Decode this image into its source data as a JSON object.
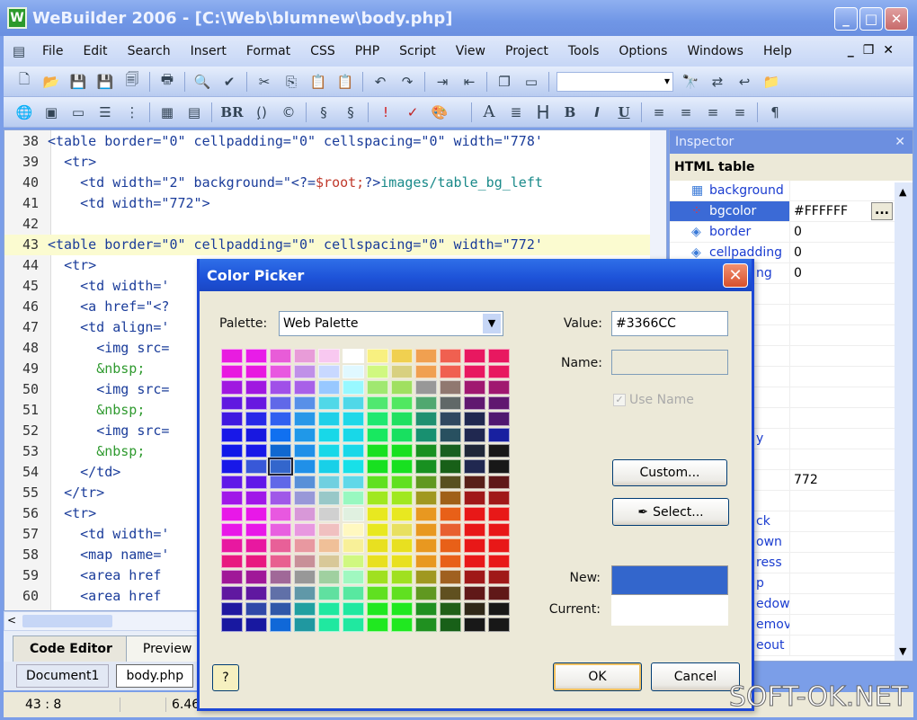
{
  "window": {
    "title": "WeBuilder 2006 - [C:\\Web\\blumnew\\body.php]",
    "app_icon": "W",
    "minimize": "_",
    "maximize": "□",
    "close": "✕"
  },
  "menu": [
    "File",
    "Edit",
    "Search",
    "Insert",
    "Format",
    "CSS",
    "PHP",
    "Script",
    "View",
    "Project",
    "Tools",
    "Options",
    "Windows",
    "Help"
  ],
  "toolbar1": [
    "new",
    "open",
    "save",
    "save-all",
    "save-as",
    "print",
    "preview",
    "spellcheck",
    "cut",
    "copy",
    "paste",
    "paste-special",
    "undo",
    "redo",
    "indent",
    "outdent",
    "window",
    "layout",
    "search-box",
    "find",
    "replace",
    "find-prev",
    "find-in-files"
  ],
  "toolbar2": {
    "icons": [
      "hyperlink",
      "image",
      "hr",
      "list",
      "tag-select",
      "table",
      "form",
      "comment",
      "color-picker"
    ],
    "br": "BR",
    "copyright": "©",
    "font": "A",
    "heading": "H",
    "bold": "B",
    "italic": "I",
    "underline": "U",
    "pilcrow": "¶"
  },
  "editor": {
    "lines": [
      {
        "n": "38",
        "indent": 0,
        "parts": [
          [
            "tag",
            "<table border=\"0\" cellpadding=\"0\" cellspacing=\"0\" width=\"778'"
          ]
        ]
      },
      {
        "n": "39",
        "indent": 1,
        "parts": [
          [
            "tag",
            "<tr>"
          ]
        ]
      },
      {
        "n": "40",
        "indent": 2,
        "parts": [
          [
            "tag",
            "<td width=\"2\" background=\"<?="
          ],
          [
            "php",
            "$root;"
          ],
          [
            "tag",
            "?>"
          ],
          [
            "teal",
            "images/table_bg_left"
          ]
        ]
      },
      {
        "n": "41",
        "indent": 2,
        "parts": [
          [
            "tag",
            "<td width=\"772\">"
          ]
        ]
      },
      {
        "n": "42",
        "indent": 0,
        "parts": []
      },
      {
        "n": "43",
        "indent": 0,
        "hl": true,
        "parts": [
          [
            "tag",
            "<table border=\"0\" cellpadding=\"0\" cellspacing=\"0\" width=\"772'"
          ]
        ]
      },
      {
        "n": "44",
        "indent": 1,
        "parts": [
          [
            "tag",
            "<tr>"
          ]
        ]
      },
      {
        "n": "45",
        "indent": 2,
        "parts": [
          [
            "tag",
            "<td width='"
          ]
        ]
      },
      {
        "n": "46",
        "indent": 2,
        "parts": [
          [
            "tag",
            "<a href=\"<?"
          ]
        ]
      },
      {
        "n": "47",
        "indent": 2,
        "parts": [
          [
            "tag",
            "<td align='"
          ]
        ]
      },
      {
        "n": "48",
        "indent": 3,
        "parts": [
          [
            "tag",
            "<img src="
          ]
        ]
      },
      {
        "n": "49",
        "indent": 3,
        "parts": [
          [
            "grn",
            "&nbsp;"
          ]
        ]
      },
      {
        "n": "50",
        "indent": 3,
        "parts": [
          [
            "tag",
            "<img src="
          ]
        ]
      },
      {
        "n": "51",
        "indent": 3,
        "parts": [
          [
            "grn",
            "&nbsp;"
          ]
        ]
      },
      {
        "n": "52",
        "indent": 3,
        "parts": [
          [
            "tag",
            "<img src="
          ]
        ]
      },
      {
        "n": "53",
        "indent": 3,
        "parts": [
          [
            "grn",
            "&nbsp;"
          ]
        ]
      },
      {
        "n": "54",
        "indent": 2,
        "parts": [
          [
            "tag",
            "</td>"
          ]
        ]
      },
      {
        "n": "55",
        "indent": 1,
        "parts": [
          [
            "tag",
            "</tr>"
          ]
        ]
      },
      {
        "n": "56",
        "indent": 1,
        "parts": [
          [
            "tag",
            "<tr>"
          ]
        ]
      },
      {
        "n": "57",
        "indent": 2,
        "parts": [
          [
            "tag",
            "<td width='"
          ]
        ]
      },
      {
        "n": "58",
        "indent": 2,
        "parts": [
          [
            "tag",
            "<map name='"
          ]
        ]
      },
      {
        "n": "59",
        "indent": 2,
        "parts": [
          [
            "tag",
            "<area href"
          ]
        ]
      },
      {
        "n": "60",
        "indent": 2,
        "parts": [
          [
            "tag",
            "<area href"
          ]
        ]
      }
    ]
  },
  "view_tabs": [
    "Code Editor",
    "Preview"
  ],
  "doc_tabs": [
    "Document1",
    "body.php"
  ],
  "status": {
    "position": "43 : 8",
    "size": "6.46"
  },
  "inspector": {
    "title": "Inspector",
    "close": "✕",
    "subtitle": "HTML table",
    "rows": [
      {
        "name": "background",
        "value": ""
      },
      {
        "name": "bgcolor",
        "value": "#FFFFFF",
        "selected": true
      },
      {
        "name": "border",
        "value": "0"
      },
      {
        "name": "cellpadding",
        "value": "0"
      },
      {
        "name": "ng",
        "value": "0"
      },
      {
        "name": "",
        "value": ""
      },
      {
        "name": "",
        "value": ""
      },
      {
        "name": "",
        "value": ""
      },
      {
        "name": "",
        "value": ""
      },
      {
        "name": "",
        "value": ""
      },
      {
        "name": "",
        "value": ""
      },
      {
        "name": "",
        "value": ""
      },
      {
        "name": "y",
        "value": ""
      },
      {
        "name": "",
        "value": ""
      },
      {
        "name": "",
        "value": "772"
      },
      {
        "name": "",
        "value": ""
      },
      {
        "name": "ck",
        "value": ""
      },
      {
        "name": "own",
        "value": ""
      },
      {
        "name": "ress",
        "value": ""
      },
      {
        "name": "p",
        "value": ""
      },
      {
        "name": "edown",
        "value": ""
      },
      {
        "name": "emov",
        "value": ""
      },
      {
        "name": "eout",
        "value": ""
      }
    ],
    "ellipsis": "..."
  },
  "dialog": {
    "title": "Color Picker",
    "close": "✕",
    "palette_label": "Palette:",
    "palette_value": "Web Palette",
    "value_label": "Value:",
    "value": "#3366CC",
    "name_label": "Name:",
    "name_value": "",
    "use_name_label": "Use Name",
    "use_name_checked": true,
    "custom_label": "Custom...",
    "select_label": "Select...",
    "new_label": "New:",
    "current_label": "Current:",
    "new_color": "#3366CC",
    "current_color": "#FFFFFF",
    "help": "?",
    "ok": "OK",
    "cancel": "Cancel",
    "selected_swatch": [
      7,
      2
    ],
    "swatches": [
      [
        "#E81CE0",
        "#E81CE8",
        "#E85CD8",
        "#E89CD8",
        "#F8C8F0",
        "#FFFFFF",
        "#F8F080",
        "#F0D050",
        "#F0A050",
        "#F06050",
        "#E81860",
        "#E81860"
      ],
      [
        "#E818E0",
        "#E818E0",
        "#E858E0",
        "#C090E8",
        "#C8D8FF",
        "#E0F8FF",
        "#D0F880",
        "#D8D080",
        "#F0A050",
        "#F06050",
        "#E81860",
        "#E81860"
      ],
      [
        "#A018E0",
        "#A018E0",
        "#A050E8",
        "#A860E8",
        "#98C8FF",
        "#98F8FF",
        "#A0E870",
        "#A0E060",
        "#989898",
        "#907870",
        "#A01870",
        "#A01870"
      ],
      [
        "#6018E0",
        "#6818E0",
        "#6068E8",
        "#5890E8",
        "#50D8E8",
        "#50D8E8",
        "#50E870",
        "#50E860",
        "#50A870",
        "#606868",
        "#601870",
        "#601870"
      ],
      [
        "#4018E0",
        "#2828E8",
        "#3060F0",
        "#2898E8",
        "#20D0E8",
        "#20D8E8",
        "#20E870",
        "#20E060",
        "#209070",
        "#304860",
        "#202850",
        "#501870"
      ],
      [
        "#1818E8",
        "#1818E0",
        "#1070F0",
        "#2098E8",
        "#18D8E8",
        "#18D8E8",
        "#18E860",
        "#18E060",
        "#189070",
        "#285060",
        "#202850",
        "#1820A0"
      ],
      [
        "#1018E8",
        "#1818E8",
        "#1068D0",
        "#2090E8",
        "#18D8E8",
        "#18D8E8",
        "#18E020",
        "#18E020",
        "#189020",
        "#186020",
        "#202838",
        "#181818"
      ],
      [
        "#1818E8",
        "#3858D8",
        "#3366CC",
        "#2090E8",
        "#18D0E8",
        "#18E0E8",
        "#18E020",
        "#18E020",
        "#189020",
        "#186018",
        "#202850",
        "#181818"
      ],
      [
        "#6018E8",
        "#6018E8",
        "#6068E8",
        "#5890D8",
        "#70D0E0",
        "#60D8E8",
        "#60E020",
        "#60E020",
        "#609820",
        "#585020",
        "#582018",
        "#601818"
      ],
      [
        "#A018E8",
        "#A018E8",
        "#A058E8",
        "#9898D8",
        "#98C8C8",
        "#98F8C0",
        "#A0E820",
        "#A0E820",
        "#A09820",
        "#A06018",
        "#A01818",
        "#A01818"
      ],
      [
        "#E818E8",
        "#E818E8",
        "#E858E0",
        "#D898D8",
        "#D0D0D0",
        "#E0F0E0",
        "#E8E820",
        "#E8E820",
        "#E89820",
        "#E86018",
        "#E81818",
        "#E81818"
      ],
      [
        "#E818E8",
        "#E818E8",
        "#E860E0",
        "#E898E0",
        "#F0C0C0",
        "#FFF8C0",
        "#E8E820",
        "#E8E060",
        "#E89820",
        "#E86030",
        "#E81818",
        "#E81818"
      ],
      [
        "#E818A0",
        "#E818A0",
        "#E86098",
        "#E898A0",
        "#F0C098",
        "#F8F098",
        "#E8E020",
        "#E8E020",
        "#E89820",
        "#E86018",
        "#E81818",
        "#E81818"
      ],
      [
        "#E81880",
        "#E81880",
        "#E86090",
        "#C89098",
        "#D8C898",
        "#D0F880",
        "#E8E020",
        "#E8E020",
        "#E89820",
        "#E86018",
        "#E81818",
        "#E81818"
      ],
      [
        "#A01898",
        "#A01898",
        "#A06898",
        "#989898",
        "#A0D0A0",
        "#A0F8C0",
        "#A0E020",
        "#A0E020",
        "#A09820",
        "#A06020",
        "#A01818",
        "#A01818"
      ],
      [
        "#6018A0",
        "#6018A0",
        "#6070A8",
        "#6098A8",
        "#60E0A0",
        "#58E8A0",
        "#60E020",
        "#60E020",
        "#609820",
        "#605020",
        "#601818",
        "#601818"
      ],
      [
        "#2018A0",
        "#3048A8",
        "#3058A8",
        "#20A0A0",
        "#20E8A0",
        "#20E8A0",
        "#20E820",
        "#20E820",
        "#209020",
        "#206018",
        "#302818",
        "#181818"
      ],
      [
        "#1818A0",
        "#1818A0",
        "#1068D8",
        "#2098A0",
        "#20E8A0",
        "#20E8A0",
        "#20E820",
        "#20E820",
        "#209020",
        "#186018",
        "#181818",
        "#181818"
      ]
    ]
  },
  "watermark": "SOFT-OK.NET"
}
